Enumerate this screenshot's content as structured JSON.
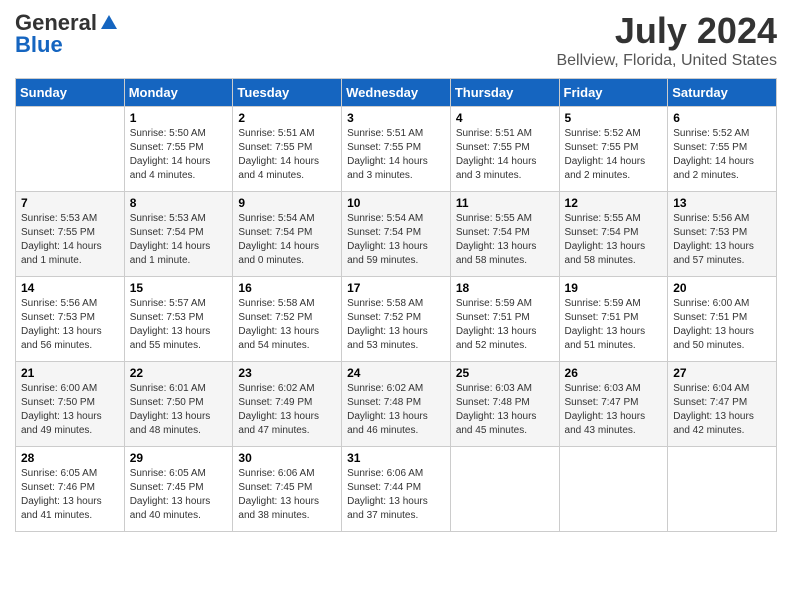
{
  "logo": {
    "general": "General",
    "blue": "Blue"
  },
  "title": "July 2024",
  "subtitle": "Bellview, Florida, United States",
  "days_of_week": [
    "Sunday",
    "Monday",
    "Tuesday",
    "Wednesday",
    "Thursday",
    "Friday",
    "Saturday"
  ],
  "weeks": [
    [
      {
        "day": "",
        "content": ""
      },
      {
        "day": "1",
        "content": "Sunrise: 5:50 AM\nSunset: 7:55 PM\nDaylight: 14 hours\nand 4 minutes."
      },
      {
        "day": "2",
        "content": "Sunrise: 5:51 AM\nSunset: 7:55 PM\nDaylight: 14 hours\nand 4 minutes."
      },
      {
        "day": "3",
        "content": "Sunrise: 5:51 AM\nSunset: 7:55 PM\nDaylight: 14 hours\nand 3 minutes."
      },
      {
        "day": "4",
        "content": "Sunrise: 5:51 AM\nSunset: 7:55 PM\nDaylight: 14 hours\nand 3 minutes."
      },
      {
        "day": "5",
        "content": "Sunrise: 5:52 AM\nSunset: 7:55 PM\nDaylight: 14 hours\nand 2 minutes."
      },
      {
        "day": "6",
        "content": "Sunrise: 5:52 AM\nSunset: 7:55 PM\nDaylight: 14 hours\nand 2 minutes."
      }
    ],
    [
      {
        "day": "7",
        "content": "Sunrise: 5:53 AM\nSunset: 7:55 PM\nDaylight: 14 hours\nand 1 minute."
      },
      {
        "day": "8",
        "content": "Sunrise: 5:53 AM\nSunset: 7:54 PM\nDaylight: 14 hours\nand 1 minute."
      },
      {
        "day": "9",
        "content": "Sunrise: 5:54 AM\nSunset: 7:54 PM\nDaylight: 14 hours\nand 0 minutes."
      },
      {
        "day": "10",
        "content": "Sunrise: 5:54 AM\nSunset: 7:54 PM\nDaylight: 13 hours\nand 59 minutes."
      },
      {
        "day": "11",
        "content": "Sunrise: 5:55 AM\nSunset: 7:54 PM\nDaylight: 13 hours\nand 58 minutes."
      },
      {
        "day": "12",
        "content": "Sunrise: 5:55 AM\nSunset: 7:54 PM\nDaylight: 13 hours\nand 58 minutes."
      },
      {
        "day": "13",
        "content": "Sunrise: 5:56 AM\nSunset: 7:53 PM\nDaylight: 13 hours\nand 57 minutes."
      }
    ],
    [
      {
        "day": "14",
        "content": "Sunrise: 5:56 AM\nSunset: 7:53 PM\nDaylight: 13 hours\nand 56 minutes."
      },
      {
        "day": "15",
        "content": "Sunrise: 5:57 AM\nSunset: 7:53 PM\nDaylight: 13 hours\nand 55 minutes."
      },
      {
        "day": "16",
        "content": "Sunrise: 5:58 AM\nSunset: 7:52 PM\nDaylight: 13 hours\nand 54 minutes."
      },
      {
        "day": "17",
        "content": "Sunrise: 5:58 AM\nSunset: 7:52 PM\nDaylight: 13 hours\nand 53 minutes."
      },
      {
        "day": "18",
        "content": "Sunrise: 5:59 AM\nSunset: 7:51 PM\nDaylight: 13 hours\nand 52 minutes."
      },
      {
        "day": "19",
        "content": "Sunrise: 5:59 AM\nSunset: 7:51 PM\nDaylight: 13 hours\nand 51 minutes."
      },
      {
        "day": "20",
        "content": "Sunrise: 6:00 AM\nSunset: 7:51 PM\nDaylight: 13 hours\nand 50 minutes."
      }
    ],
    [
      {
        "day": "21",
        "content": "Sunrise: 6:00 AM\nSunset: 7:50 PM\nDaylight: 13 hours\nand 49 minutes."
      },
      {
        "day": "22",
        "content": "Sunrise: 6:01 AM\nSunset: 7:50 PM\nDaylight: 13 hours\nand 48 minutes."
      },
      {
        "day": "23",
        "content": "Sunrise: 6:02 AM\nSunset: 7:49 PM\nDaylight: 13 hours\nand 47 minutes."
      },
      {
        "day": "24",
        "content": "Sunrise: 6:02 AM\nSunset: 7:48 PM\nDaylight: 13 hours\nand 46 minutes."
      },
      {
        "day": "25",
        "content": "Sunrise: 6:03 AM\nSunset: 7:48 PM\nDaylight: 13 hours\nand 45 minutes."
      },
      {
        "day": "26",
        "content": "Sunrise: 6:03 AM\nSunset: 7:47 PM\nDaylight: 13 hours\nand 43 minutes."
      },
      {
        "day": "27",
        "content": "Sunrise: 6:04 AM\nSunset: 7:47 PM\nDaylight: 13 hours\nand 42 minutes."
      }
    ],
    [
      {
        "day": "28",
        "content": "Sunrise: 6:05 AM\nSunset: 7:46 PM\nDaylight: 13 hours\nand 41 minutes."
      },
      {
        "day": "29",
        "content": "Sunrise: 6:05 AM\nSunset: 7:45 PM\nDaylight: 13 hours\nand 40 minutes."
      },
      {
        "day": "30",
        "content": "Sunrise: 6:06 AM\nSunset: 7:45 PM\nDaylight: 13 hours\nand 38 minutes."
      },
      {
        "day": "31",
        "content": "Sunrise: 6:06 AM\nSunset: 7:44 PM\nDaylight: 13 hours\nand 37 minutes."
      },
      {
        "day": "",
        "content": ""
      },
      {
        "day": "",
        "content": ""
      },
      {
        "day": "",
        "content": ""
      }
    ]
  ]
}
